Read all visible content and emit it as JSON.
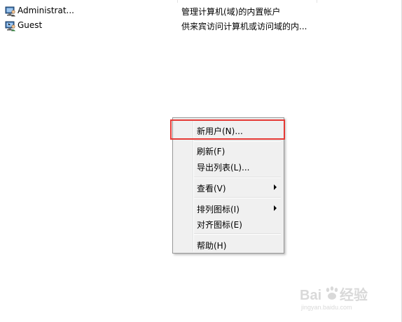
{
  "users": [
    {
      "name": "Administrat...",
      "description": "管理计算机(域)的内置帐户",
      "icon": "user-admin-icon"
    },
    {
      "name": "Guest",
      "description": "供来宾访问计算机或访问域的内...",
      "icon": "user-guest-icon"
    }
  ],
  "context_menu": {
    "items": [
      {
        "label": "新用户(N)...",
        "has_submenu": false,
        "highlighted": true
      },
      {
        "label": "刷新(F)",
        "has_submenu": false
      },
      {
        "label": "导出列表(L)...",
        "has_submenu": false
      },
      {
        "label": "查看(V)",
        "has_submenu": true
      },
      {
        "label": "排列图标(I)",
        "has_submenu": true
      },
      {
        "label": "对齐图标(E)",
        "has_submenu": false
      },
      {
        "label": "帮助(H)",
        "has_submenu": false
      }
    ]
  },
  "watermark": {
    "brand": "Baidu 经验",
    "url": "jingyan.baidu.com"
  },
  "colors": {
    "highlight_box": "#e53935",
    "menu_bg": "#f0f0f0"
  }
}
